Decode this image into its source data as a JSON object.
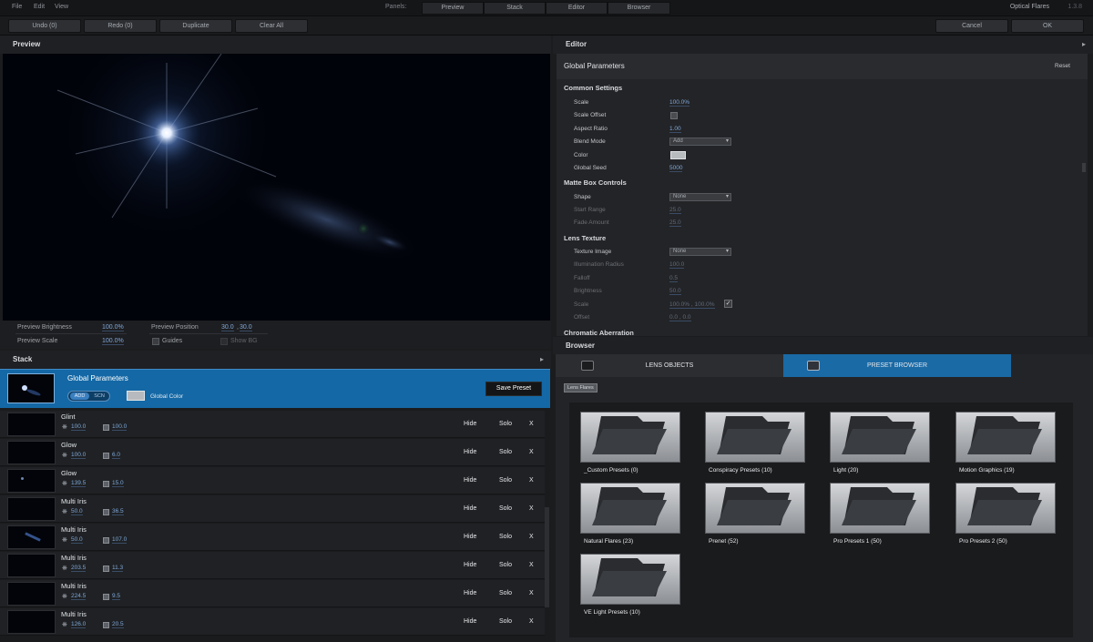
{
  "menu": {
    "file": "File",
    "edit": "Edit",
    "view": "View"
  },
  "panels": {
    "label": "Panels:",
    "tabs": [
      "Preview",
      "Stack",
      "Editor",
      "Browser"
    ]
  },
  "app": {
    "title": "Optical Flares",
    "version": "1.3.8"
  },
  "toolbar": {
    "undo": "Undo (0)",
    "redo": "Redo (0)",
    "duplicate": "Duplicate",
    "clear_all": "Clear All",
    "cancel": "Cancel",
    "ok": "OK"
  },
  "preview": {
    "title": "Preview",
    "brightness_label": "Preview Brightness",
    "brightness_value": "100.0%",
    "scale_label": "Preview Scale",
    "scale_value": "100.0%",
    "position_label": "Preview Position",
    "position_x": "30.0",
    "position_sep": ",",
    "position_y": "30.0",
    "guides_label": "Guides",
    "showbg_label": "Show BG"
  },
  "stack": {
    "title": "Stack",
    "global": {
      "title": "Global Parameters",
      "add": "ADD",
      "scn": "SCN",
      "color_label": "Global Color",
      "save_preset": "Save Preset"
    },
    "hide": "Hide",
    "solo": "Solo",
    "x": "X",
    "rows": [
      {
        "name": "Glint",
        "v1": "100.0",
        "v2": "100.0"
      },
      {
        "name": "Glow",
        "v1": "100.0",
        "v2": "6.0"
      },
      {
        "name": "Glow",
        "v1": "139.5",
        "v2": "15.0"
      },
      {
        "name": "Multi Iris",
        "v1": "50.0",
        "v2": "36.5"
      },
      {
        "name": "Multi Iris",
        "v1": "50.0",
        "v2": "107.0"
      },
      {
        "name": "Multi Iris",
        "v1": "203.5",
        "v2": "11.3"
      },
      {
        "name": "Multi Iris",
        "v1": "224.5",
        "v2": "9.5"
      },
      {
        "name": "Multi Iris",
        "v1": "126.0",
        "v2": "20.5"
      }
    ]
  },
  "editor": {
    "title": "Editor",
    "section_title": "Global Parameters",
    "reset": "Reset",
    "common": {
      "title": "Common Settings",
      "scale_label": "Scale",
      "scale_value": "100.0%",
      "scale_offset_label": "Scale Offset",
      "aspect_label": "Aspect Ratio",
      "aspect_value": "1.00",
      "blend_label": "Blend Mode",
      "blend_value": "Add",
      "color_label": "Color",
      "seed_label": "Global Seed",
      "seed_value": "5000"
    },
    "matte": {
      "title": "Matte Box Controls",
      "shape_label": "Shape",
      "shape_value": "None",
      "start_label": "Start Range",
      "start_value": "25.0",
      "fade_label": "Fade Amount",
      "fade_value": "25.0"
    },
    "lens": {
      "title": "Lens Texture",
      "texture_label": "Texture Image",
      "texture_value": "None",
      "illum_label": "Illumination Radius",
      "illum_value": "100.0",
      "falloff_label": "Falloff",
      "falloff_value": "0.5",
      "brightness_label": "Brightness",
      "brightness_value": "50.0",
      "scale_label": "Scale",
      "scale_value": "100.0% , 100.0%",
      "offset_label": "Offset",
      "offset_value": "0.0 , 0.0"
    },
    "chromatic": {
      "title": "Chromatic Aberration"
    }
  },
  "browser": {
    "title": "Browser",
    "tab_lens": "LENS OBJECTS",
    "tab_preset": "PRESET BROWSER",
    "breadcrumb": "Lens Flares",
    "folders": [
      "_Custom Presets (0)",
      "Conspiracy Presets (10)",
      "Light (20)",
      "Motion Graphics (19)",
      "Natural Flares (23)",
      "Prenet (52)",
      "Pro Presets 1 (50)",
      "Pro Presets 2 (50)",
      "VE Light Presets (10)"
    ]
  }
}
